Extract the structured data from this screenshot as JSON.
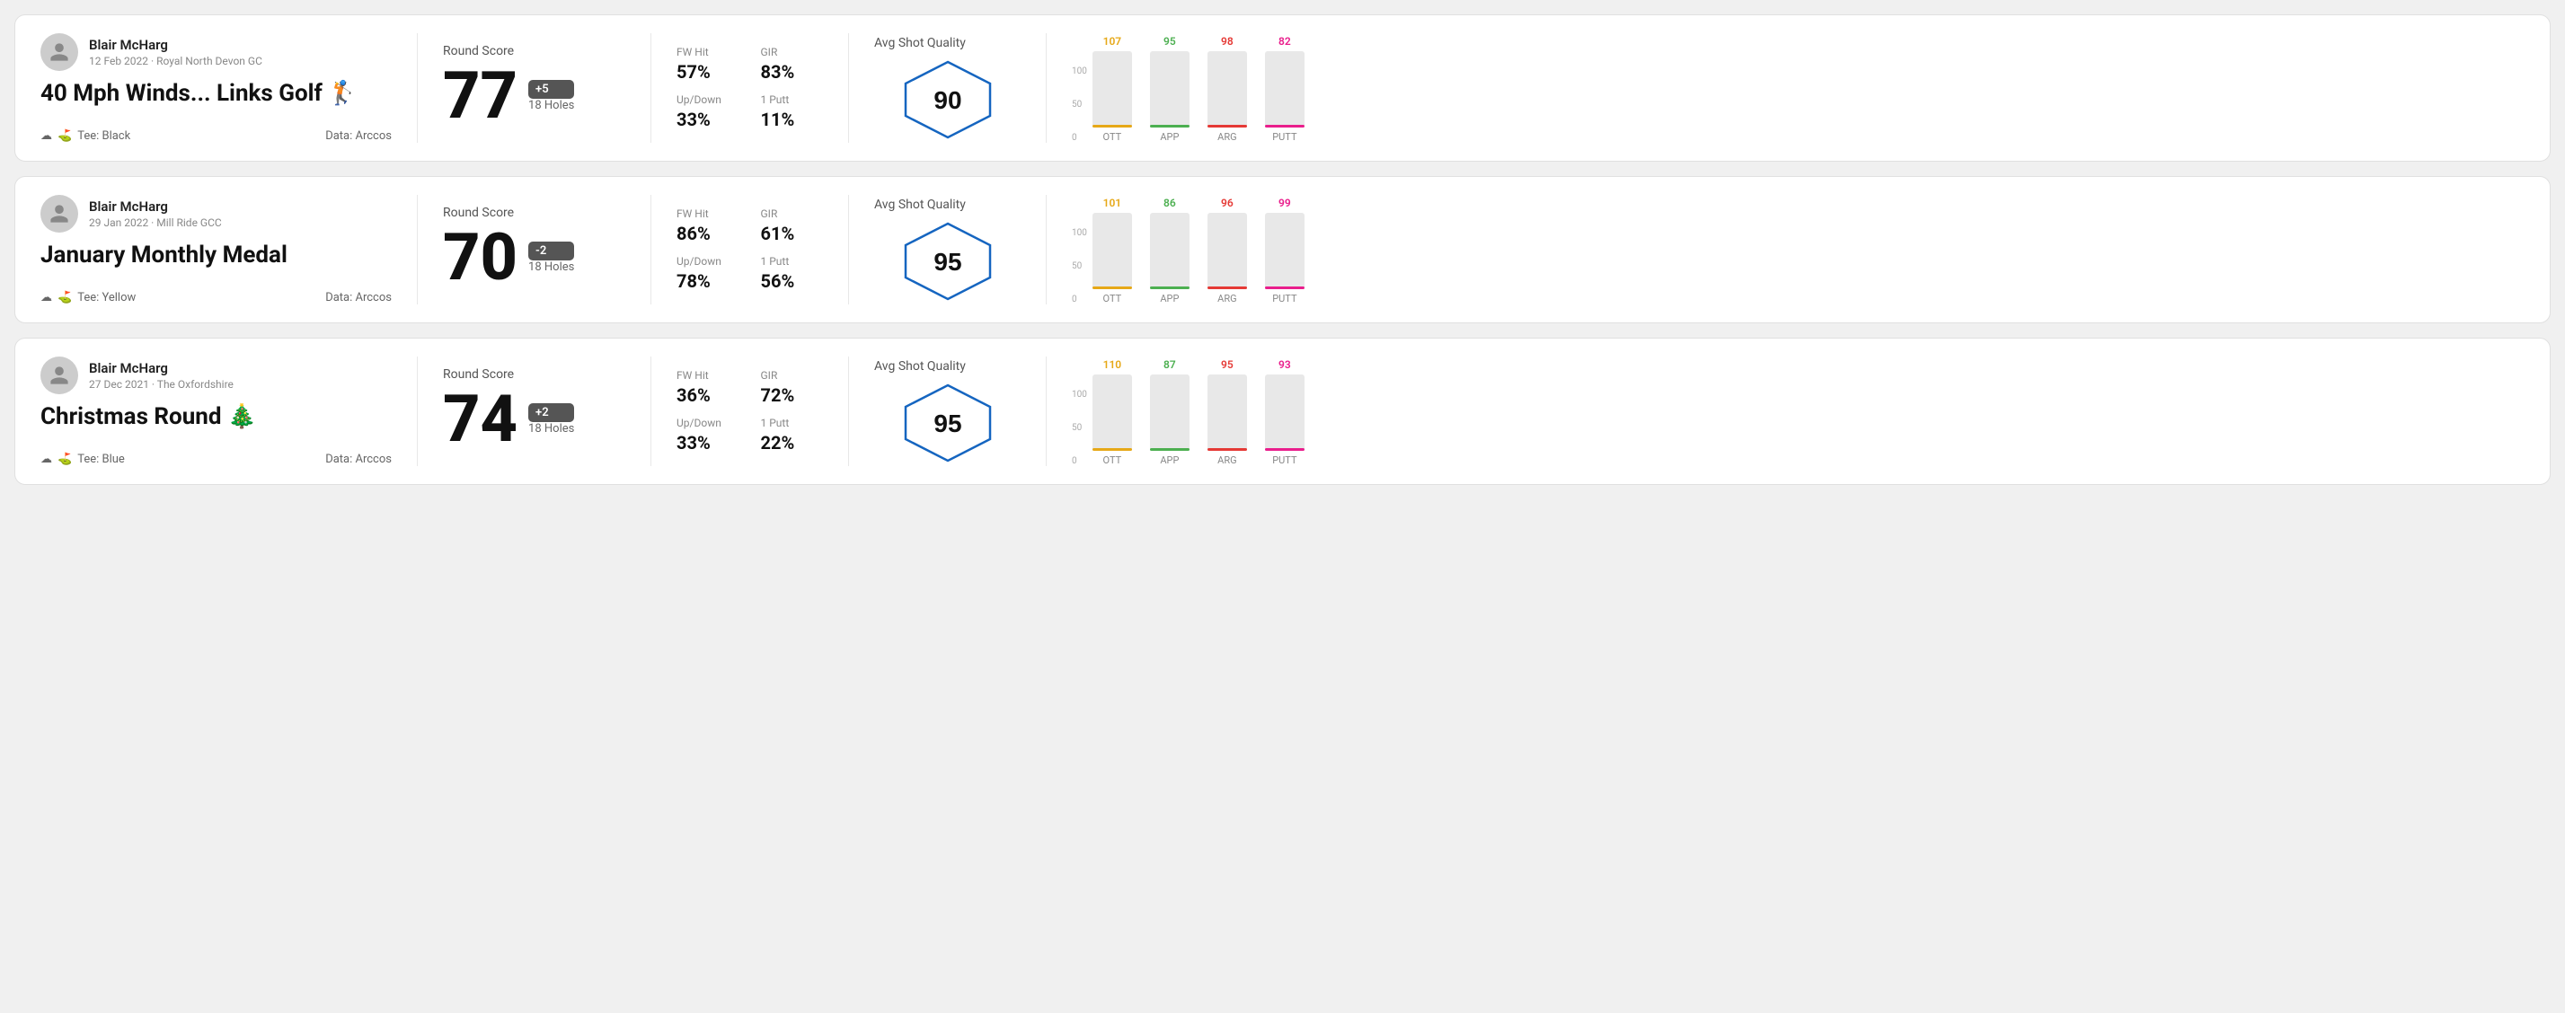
{
  "rounds": [
    {
      "id": "round1",
      "user": "Blair McHarg",
      "date": "12 Feb 2022 · Royal North Devon GC",
      "title": "40 Mph Winds... Links Golf",
      "title_emoji": "🏌",
      "tee": "Black",
      "data_source": "Data: Arccos",
      "round_score_label": "Round Score",
      "score": "77",
      "score_diff": "+5",
      "score_diff_sign": "positive",
      "holes": "18 Holes",
      "fw_hit_label": "FW Hit",
      "fw_hit": "57%",
      "gir_label": "GIR",
      "gir": "83%",
      "updown_label": "Up/Down",
      "updown": "33%",
      "oneputt_label": "1 Putt",
      "oneputt": "11%",
      "quality_label": "Avg Shot Quality",
      "quality_score": "90",
      "chart_bars": [
        {
          "label": "OTT",
          "value": 107,
          "color": "#e6a817",
          "pct": 78
        },
        {
          "label": "APP",
          "value": 95,
          "color": "#4caf50",
          "pct": 68
        },
        {
          "label": "ARG",
          "value": 98,
          "color": "#e53935",
          "pct": 72
        },
        {
          "label": "PUTT",
          "value": 82,
          "color": "#e91e8c",
          "pct": 58
        }
      ]
    },
    {
      "id": "round2",
      "user": "Blair McHarg",
      "date": "29 Jan 2022 · Mill Ride GCC",
      "title": "January Monthly Medal",
      "title_emoji": "",
      "tee": "Yellow",
      "data_source": "Data: Arccos",
      "round_score_label": "Round Score",
      "score": "70",
      "score_diff": "-2",
      "score_diff_sign": "negative",
      "holes": "18 Holes",
      "fw_hit_label": "FW Hit",
      "fw_hit": "86%",
      "gir_label": "GIR",
      "gir": "61%",
      "updown_label": "Up/Down",
      "updown": "78%",
      "oneputt_label": "1 Putt",
      "oneputt": "56%",
      "quality_label": "Avg Shot Quality",
      "quality_score": "95",
      "chart_bars": [
        {
          "label": "OTT",
          "value": 101,
          "color": "#e6a817",
          "pct": 74
        },
        {
          "label": "APP",
          "value": 86,
          "color": "#4caf50",
          "pct": 62
        },
        {
          "label": "ARG",
          "value": 96,
          "color": "#e53935",
          "pct": 71
        },
        {
          "label": "PUTT",
          "value": 99,
          "color": "#e91e8c",
          "pct": 73
        }
      ]
    },
    {
      "id": "round3",
      "user": "Blair McHarg",
      "date": "27 Dec 2021 · The Oxfordshire",
      "title": "Christmas Round",
      "title_emoji": "🎄",
      "tee": "Blue",
      "data_source": "Data: Arccos",
      "round_score_label": "Round Score",
      "score": "74",
      "score_diff": "+2",
      "score_diff_sign": "positive",
      "holes": "18 Holes",
      "fw_hit_label": "FW Hit",
      "fw_hit": "36%",
      "gir_label": "GIR",
      "gir": "72%",
      "updown_label": "Up/Down",
      "updown": "33%",
      "oneputt_label": "1 Putt",
      "oneputt": "22%",
      "quality_label": "Avg Shot Quality",
      "quality_score": "95",
      "chart_bars": [
        {
          "label": "OTT",
          "value": 110,
          "color": "#e6a817",
          "pct": 82
        },
        {
          "label": "APP",
          "value": 87,
          "color": "#4caf50",
          "pct": 63
        },
        {
          "label": "ARG",
          "value": 95,
          "color": "#e53935",
          "pct": 70
        },
        {
          "label": "PUTT",
          "value": 93,
          "color": "#e91e8c",
          "pct": 68
        }
      ]
    }
  ]
}
